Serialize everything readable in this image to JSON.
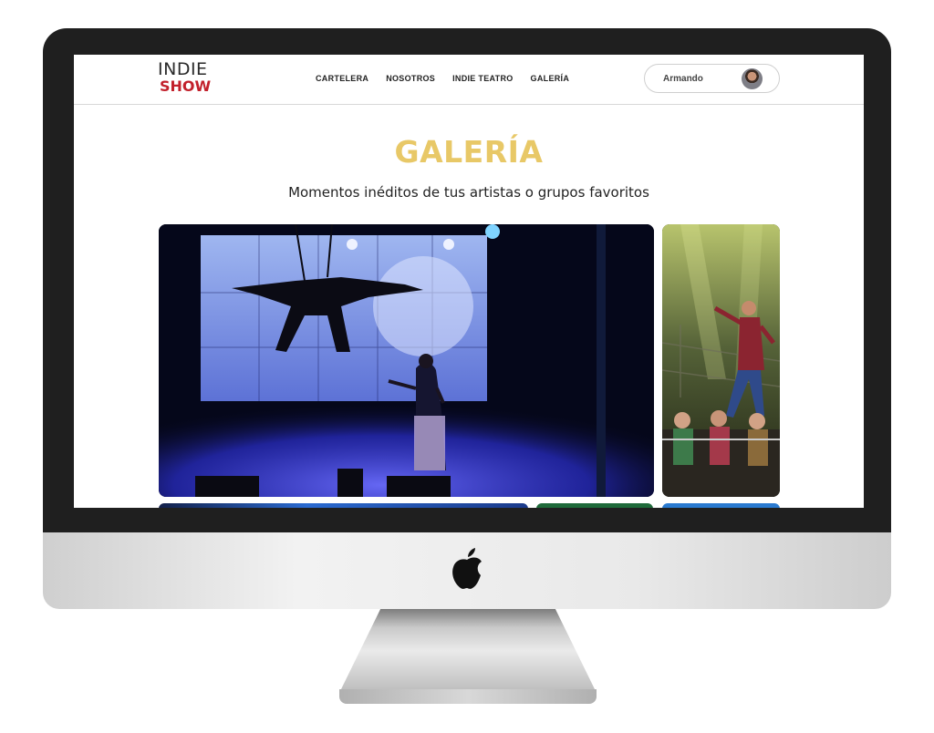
{
  "site": {
    "logo_line1": "INDIE",
    "logo_line2": "SHOW"
  },
  "nav": {
    "items": [
      "CARTELERA",
      "NOSOTROS",
      "INDIE TEATRO",
      "GALERÍA"
    ]
  },
  "user": {
    "name": "Armando"
  },
  "gallery": {
    "title": "GALERÍA",
    "subtitle": "Momentos inéditos de tus artistas o grupos favoritos",
    "images": [
      {
        "name": "aerial-performance-photo",
        "description": "blue lit stage"
      },
      {
        "name": "musical-performance-photo",
        "description": "green lit stage"
      }
    ]
  },
  "colors": {
    "accent": "#e8c867",
    "brand_red": "#c2202b",
    "bezel": "#1f1f1f"
  },
  "icons": [
    "apple-icon"
  ]
}
